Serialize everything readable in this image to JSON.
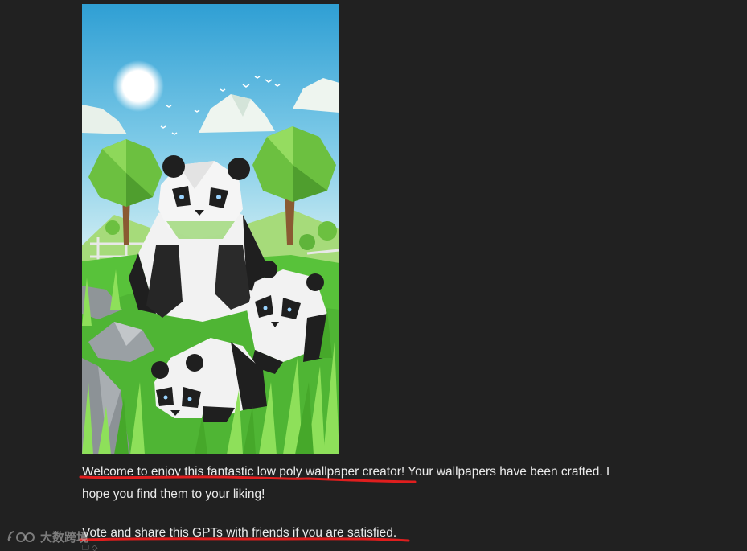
{
  "generated_image": {
    "subject": "low poly panda wallpaper",
    "colors": {
      "sky_top": "#3fa8d8",
      "sky_bottom": "#bfe7f2",
      "grass": "#58c23a",
      "grass_light": "#8ee05a",
      "panda_white": "#f2f2f2",
      "panda_black": "#1f1f1f",
      "tree_green": "#6cc040",
      "trunk": "#8a5a32",
      "rock": "#9aa0a4"
    }
  },
  "message": {
    "paragraph_1": "Welcome to enjoy this fantastic low poly wallpaper creator! Your wallpapers have been crafted. I hope you find them to your liking!",
    "paragraph_2": "Vote and share this GPTs with friends if you are satisfied."
  },
  "annotation": {
    "underline_color": "#e01e1e"
  },
  "watermark": {
    "text": "大数跨境"
  }
}
